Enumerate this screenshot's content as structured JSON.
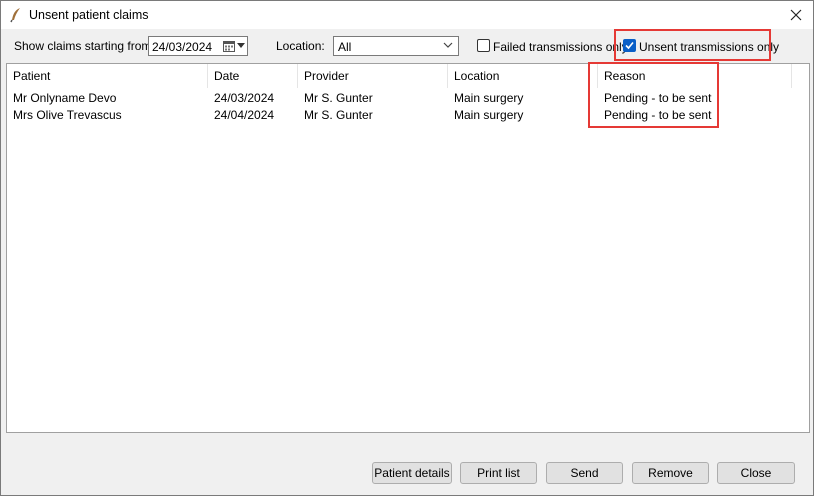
{
  "window": {
    "title": "Unsent patient claims",
    "app_icon": "quill-icon",
    "close_icon": "close-icon"
  },
  "filters": {
    "start_label": "Show claims starting from:",
    "start_date": "24/03/2024",
    "location_label": "Location:",
    "location_value": "All",
    "failed_label": "Failed transmissions only",
    "failed_checked": false,
    "unsent_label": "Unsent transmissions only",
    "unsent_checked": true
  },
  "table": {
    "headers": [
      "Patient",
      "Date",
      "Provider",
      "Location",
      "Reason"
    ],
    "rows": [
      [
        "Mr Onlyname Devo",
        "24/03/2024",
        "Mr S. Gunter",
        "Main surgery",
        "Pending - to be sent"
      ],
      [
        "Mrs Olive Trevascus",
        "24/04/2024",
        "Mr S. Gunter",
        "Main surgery",
        "Pending - to be sent"
      ]
    ]
  },
  "buttons": {
    "patient_details": "Patient details",
    "print_list": "Print list",
    "send": "Send",
    "remove": "Remove",
    "close": "Close"
  },
  "colors": {
    "highlight": "#e53935",
    "checkbox_accent": "#0a5fc7"
  }
}
